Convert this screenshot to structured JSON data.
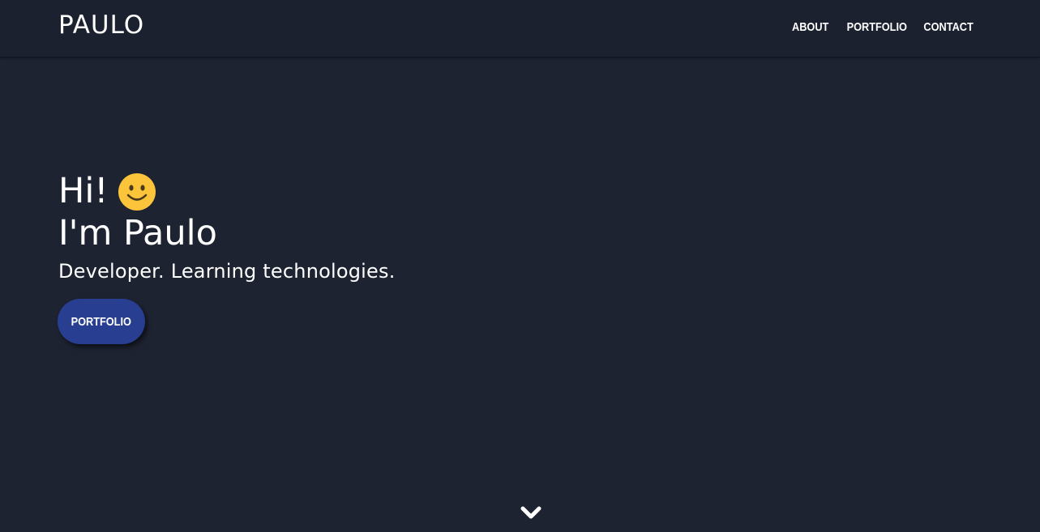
{
  "navbar": {
    "brand": "PAULO",
    "links": [
      {
        "label": "ABOUT"
      },
      {
        "label": "PORTFOLIO"
      },
      {
        "label": "CONTACT"
      }
    ]
  },
  "hero": {
    "greeting": "Hi!",
    "greeting_icon": "smiley-face-icon",
    "name": "I'm Paulo",
    "tagline": "Developer. Learning technologies.",
    "button_label": "PORTFOLIO"
  },
  "scroll_icon": "chevron-down-icon",
  "colors": {
    "background": "#1e2332",
    "navbar": "#1c2130",
    "button": "#283e90",
    "smiley": "#fcc43a",
    "text": "#ffffff"
  }
}
